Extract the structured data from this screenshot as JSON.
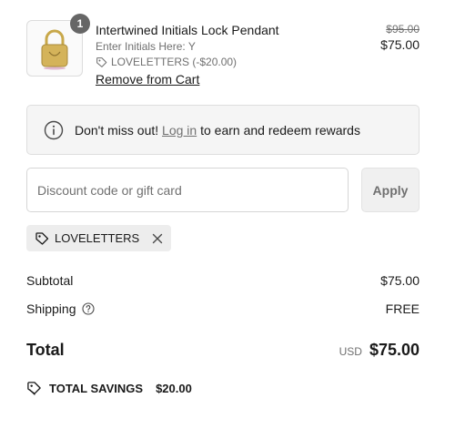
{
  "line_item": {
    "quantity": "1",
    "name": "Intertwined Initials Lock Pendant",
    "property": "Enter Initials Here: Y",
    "discount": "LOVELETTERS (-$20.00)",
    "remove_label": "Remove from Cart",
    "original_price": "$95.00",
    "price": "$75.00",
    "image_icon": "gold-lock-pendant"
  },
  "rewards": {
    "before": "Don't miss out!",
    "link": "Log in",
    "after": "to earn and redeem rewards"
  },
  "discount_form": {
    "placeholder": "Discount code or gift card",
    "value": "",
    "apply_label": "Apply"
  },
  "applied_code": {
    "code": "LOVELETTERS"
  },
  "summary": {
    "subtotal_label": "Subtotal",
    "subtotal_value": "$75.00",
    "shipping_label": "Shipping",
    "shipping_value": "FREE",
    "total_label": "Total",
    "currency": "USD",
    "total_value": "$75.00",
    "savings_label": "TOTAL SAVINGS",
    "savings_value": "$20.00"
  },
  "colors": {
    "text": "#1a1a1a",
    "muted": "#707070",
    "badge": "#666666",
    "panel_bg": "#f5f5f5",
    "tag_bg": "#ededed"
  }
}
